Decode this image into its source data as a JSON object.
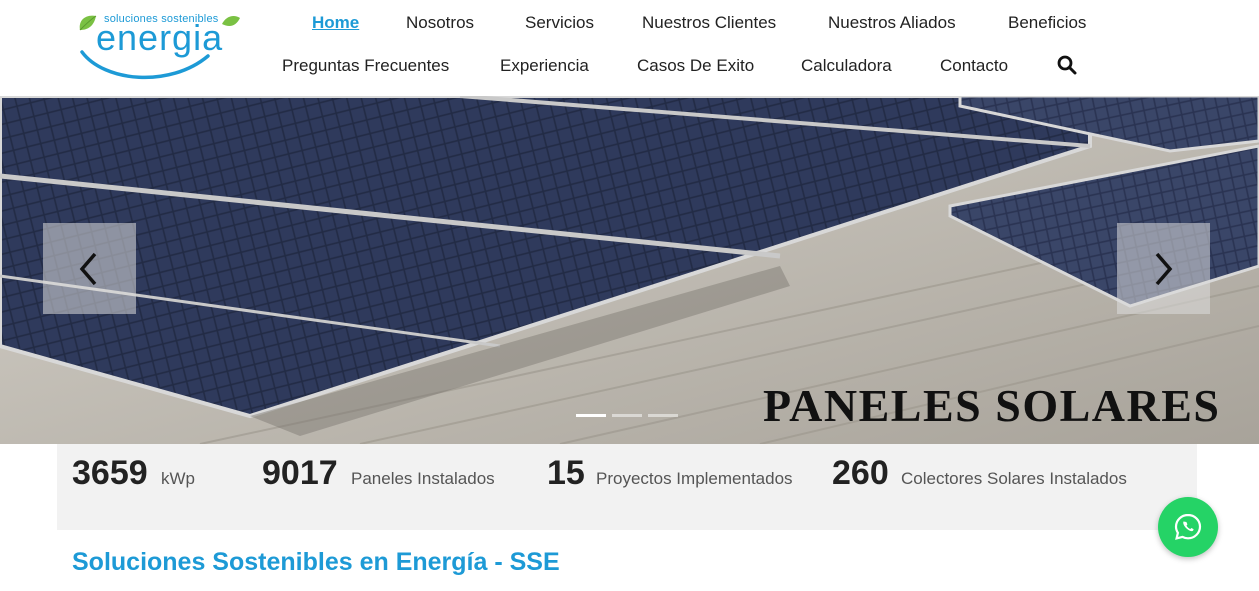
{
  "logo": {
    "tagline": "soluciones sostenibles",
    "name": "energia",
    "color": "#1d9ad6",
    "leaf_color": "#7ac143"
  },
  "nav": {
    "row1": [
      "Home",
      "Nosotros",
      "Servicios",
      "Nuestros Clientes",
      "Nuestros Aliados",
      "Beneficios"
    ],
    "row2": [
      "Preguntas Frecuentes",
      "Experiencia",
      "Casos De Exito",
      "Calculadora",
      "Contacto"
    ],
    "active": "Home",
    "search_icon": "search-icon"
  },
  "hero": {
    "caption": "PANELES SOLARES",
    "slide_count": 3,
    "active_slide": 1,
    "prev_icon": "chevron-left-icon",
    "next_icon": "chevron-right-icon"
  },
  "stats": [
    {
      "number": "3659",
      "label": "kWp"
    },
    {
      "number": "9017",
      "label": "Paneles Instalados"
    },
    {
      "number": "15",
      "label": "Proyectos Implementados"
    },
    {
      "number": "260",
      "label": "Colectores Solares Instalados"
    }
  ],
  "whatsapp": {
    "icon": "whatsapp-icon",
    "color": "#25d366"
  },
  "section": {
    "title": "Soluciones Sostenibles en Energía - SSE"
  }
}
